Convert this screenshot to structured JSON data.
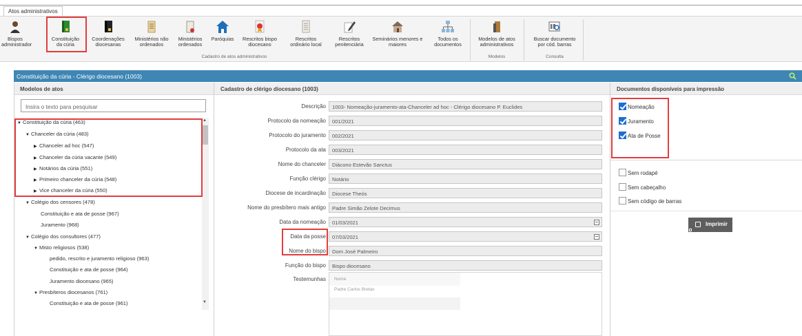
{
  "ribbon": {
    "tab": "Atos administrativos",
    "buttons": [
      {
        "label1": "Bispos",
        "label2": "administrador"
      },
      {
        "label1": "Constituição",
        "label2": "da cúria"
      },
      {
        "label1": "Coordenações",
        "label2": "diocesanas"
      },
      {
        "label1": "Ministérios não",
        "label2": "ordenados"
      },
      {
        "label1": "Ministérios",
        "label2": "ordenados"
      },
      {
        "label1": "Paróquias",
        "label2": ""
      },
      {
        "label1": "Rescritos bispo",
        "label2": "diocesano"
      },
      {
        "label1": "Rescritos",
        "label2": "ordinário local"
      },
      {
        "label1": "Rescritos",
        "label2": "penitenciária"
      },
      {
        "label1": "Seminários menores e",
        "label2": "maiores"
      },
      {
        "label1": "Todos os",
        "label2": "documentos"
      },
      {
        "label1": "Modelos de atos",
        "label2": "administrativos"
      },
      {
        "label1": "Buscar documento",
        "label2": "por cód. barras"
      }
    ],
    "groups": {
      "cadastro": "Cadastro de atos administrativos",
      "modelos": "Modelos",
      "consulta": "Consulta"
    }
  },
  "window": {
    "title": "Constituição da cúria - Clérigo diocesano (1003)"
  },
  "left": {
    "header": "Modelos de atos",
    "search_placeholder": "Insira o texto para pesquisar",
    "tree": [
      {
        "label": "Constituição da cúria (463)",
        "tri": "▼"
      },
      {
        "label": "Chanceler da cúria (483)",
        "tri": "▼"
      },
      {
        "label": "Chanceler ad hoc (547)",
        "tri": "▶"
      },
      {
        "label": "Chanceler da cúria vacante (549)",
        "tri": "▶"
      },
      {
        "label": "Notários da cúria (551)",
        "tri": "▶"
      },
      {
        "label": "Primeiro chanceler da cúria (548)",
        "tri": "▶"
      },
      {
        "label": "Vice chanceler da cúria (550)",
        "tri": "▶"
      },
      {
        "label": "Colégio dos censores (478)",
        "tri": "▼"
      },
      {
        "label": "Constituição e ata de posse (967)",
        "tri": ""
      },
      {
        "label": "Juramento (968)",
        "tri": ""
      },
      {
        "label": "Colégio dos consultores (477)",
        "tri": "▼"
      },
      {
        "label": "Misto religiosos (538)",
        "tri": "▼"
      },
      {
        "label": "pedido, rescrito e juramento religioso (963)",
        "tri": ""
      },
      {
        "label": "Constituição e ata de posse (964)",
        "tri": ""
      },
      {
        "label": "Juramento diocesano (965)",
        "tri": ""
      },
      {
        "label": "Presbíteros diocesanos (761)",
        "tri": "▼"
      },
      {
        "label": "Constituição e ata de posse (961)",
        "tri": ""
      }
    ]
  },
  "form": {
    "header": "Cadastro de clérigo diocesano (1003)",
    "fields": [
      {
        "label": "Descrição",
        "value": "1003- Nomeação-juramento-ata-Chanceler ad hoc - Clérigo diocesano P. Euclides"
      },
      {
        "label": "Protocolo da nomeação",
        "value": "001/2021"
      },
      {
        "label": "Protocolo do juramento",
        "value": "002/2021"
      },
      {
        "label": "Protocolo da ata",
        "value": "003/2021"
      },
      {
        "label": "Nome do chanceler",
        "value": "Diácono Estevão Sanctus"
      },
      {
        "label": "Função clérigo",
        "value": "Notário"
      },
      {
        "label": "Diocese de incardinação",
        "value": "Diocese Theós"
      },
      {
        "label": "Nome do presbítero mais antigo",
        "value": "Padre Simão Zelote Decimus"
      },
      {
        "label": "Data da nomeação",
        "value": "01/03/2021"
      },
      {
        "label": "Data da posse",
        "value": "07/03/2021"
      },
      {
        "label": "Nome do bispo",
        "value": "Dom José Palmeiro"
      },
      {
        "label": "Função do bispo",
        "value": "Bispo diocesano"
      }
    ],
    "witnesses_label": "Testemunhas",
    "witnesses_col": "Nome",
    "witnesses": [
      "Padre Carlos Bretas"
    ]
  },
  "right": {
    "header": "Documentos disponíveis para impressão",
    "docs": [
      {
        "label": "Nomeação",
        "checked": true
      },
      {
        "label": "Juramento",
        "checked": true
      },
      {
        "label": "Ata de Posse",
        "checked": true
      }
    ],
    "options": [
      {
        "label": "Sem rodapé",
        "checked": false
      },
      {
        "label": "Sem cabeçalho",
        "checked": false
      },
      {
        "label": "Sem código de barras",
        "checked": false
      }
    ],
    "print_label": "Imprimir"
  },
  "colors": {
    "title_bar": "#3f86b4",
    "highlight": "#e23c3c",
    "checkbox": "#1d6fd0",
    "print_button": "#5e5e5e"
  }
}
